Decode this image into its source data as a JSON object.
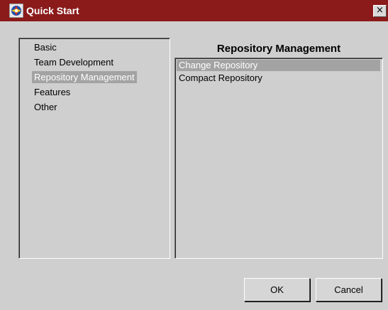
{
  "window": {
    "title": "Quick Start",
    "close_glyph": "×"
  },
  "categories": {
    "items": [
      {
        "label": "Basic",
        "selected": false
      },
      {
        "label": "Team Development",
        "selected": false
      },
      {
        "label": "Repository Management",
        "selected": true
      },
      {
        "label": "Features",
        "selected": false
      },
      {
        "label": "Other",
        "selected": false
      }
    ]
  },
  "detail": {
    "heading": "Repository Management",
    "items": [
      {
        "label": "Change Repository",
        "selected": true
      },
      {
        "label": "Compact Repository",
        "selected": false
      }
    ]
  },
  "buttons": {
    "ok_label": "OK",
    "cancel_label": "Cancel"
  },
  "colors": {
    "titlebar": "#8b1a1a",
    "window_bg": "#cfcfcf",
    "selection_bg": "#a3a3a3"
  },
  "icons": {
    "app": "quick-start-app-icon",
    "close": "close-icon"
  }
}
